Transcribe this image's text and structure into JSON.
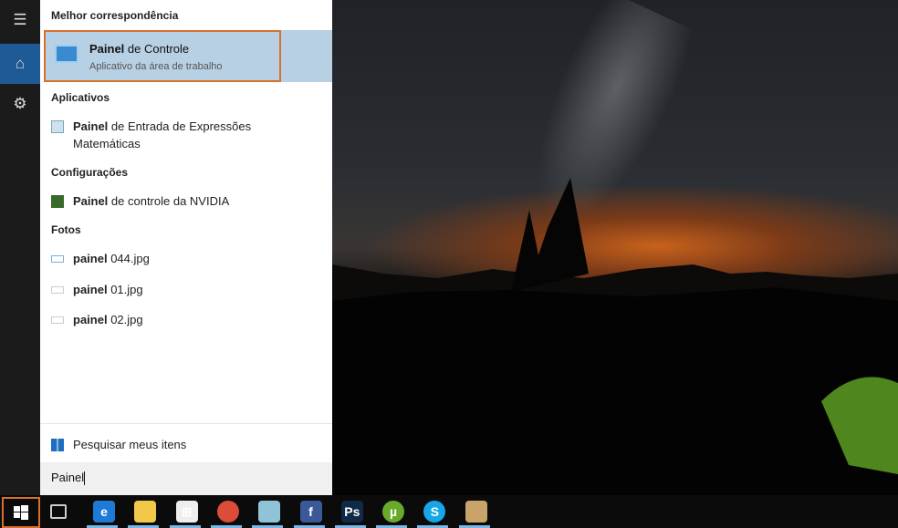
{
  "rail": {
    "menu": "menu-icon",
    "home": "home-icon",
    "settings": "gear-icon"
  },
  "best_match": {
    "header": "Melhor correspondência",
    "title_bold": "Painel",
    "title_rest": " de Controle",
    "subtitle": "Aplicativo da área de trabalho"
  },
  "apps": {
    "header": "Aplicativos",
    "items": [
      {
        "bold": "Painel",
        "rest": " de Entrada de Expressões Matemáticas"
      }
    ]
  },
  "settings": {
    "header": "Configurações",
    "items": [
      {
        "bold": "Painel",
        "rest": " de controle da NVIDIA"
      }
    ]
  },
  "photos": {
    "header": "Fotos",
    "items": [
      {
        "bold": "painel",
        "rest": " 044.jpg"
      },
      {
        "bold": "painel",
        "rest": " 01.jpg"
      },
      {
        "bold": "painel",
        "rest": " 02.jpg"
      }
    ]
  },
  "footer": {
    "label": "Pesquisar meus itens"
  },
  "search": {
    "value": "Painel"
  },
  "taskbar": {
    "apps": [
      {
        "name": "edge",
        "glyph": "e",
        "color": "#1d7ad6"
      },
      {
        "name": "file-explorer",
        "glyph": "",
        "color": "#f2c84b"
      },
      {
        "name": "store",
        "glyph": "⊞",
        "color": "#eee"
      },
      {
        "name": "chrome",
        "glyph": "",
        "color": "#dd4b39"
      },
      {
        "name": "notepad",
        "glyph": "",
        "color": "#8fc4d8"
      },
      {
        "name": "facebook",
        "glyph": "f",
        "color": "#3b5998"
      },
      {
        "name": "photoshop",
        "glyph": "Ps",
        "color": "#0e2a46"
      },
      {
        "name": "utorrent",
        "glyph": "µ",
        "color": "#6aaa2a"
      },
      {
        "name": "skype",
        "glyph": "S",
        "color": "#17a6e8"
      },
      {
        "name": "paint",
        "glyph": "",
        "color": "#c9a46a"
      }
    ]
  }
}
